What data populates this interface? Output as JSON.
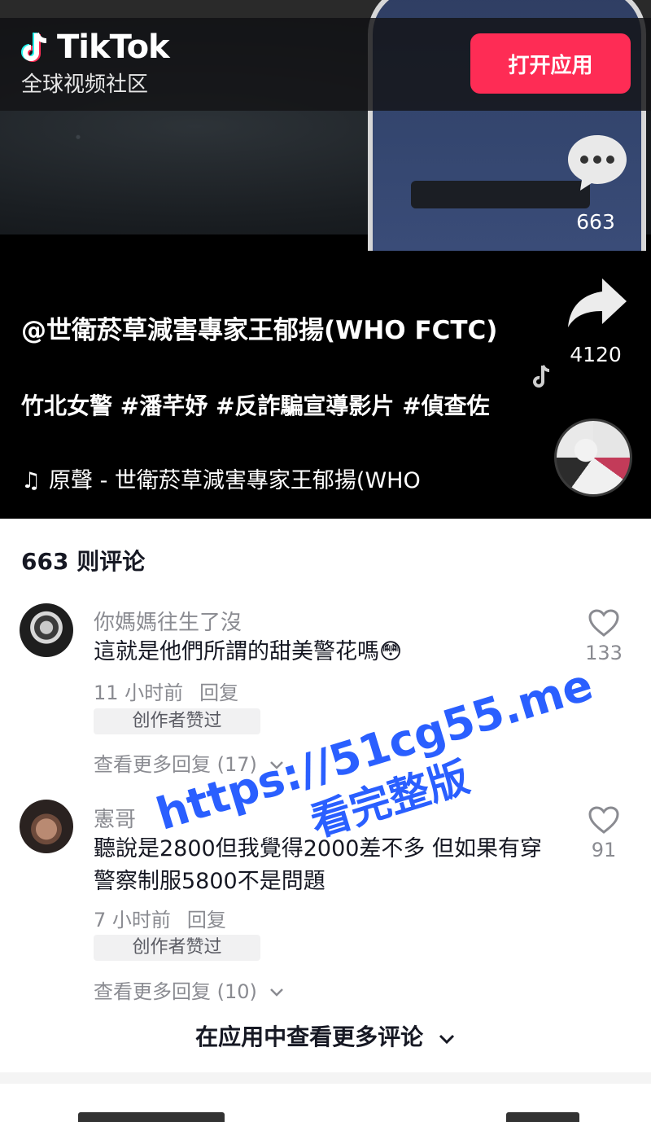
{
  "header": {
    "logo_text": "TikTok",
    "logo_subtitle": "全球视频社区",
    "open_app_label": "打开应用"
  },
  "video": {
    "comment_count": "663",
    "share_count": "4120",
    "caption": "@世衛菸草減害專家王郁揚(WHO FCTC)",
    "tags": "竹北女警 #潘芊妤 #反詐騙宣導影片 #偵查佐",
    "music_glyph": "♫",
    "music": "原聲 - 世衛菸草減害專家王郁揚(WHO"
  },
  "comments_section": {
    "title": "663 则评论",
    "comments": [
      {
        "user": "你媽媽往生了沒",
        "text": "這就是他們所謂的甜美警花嗎😳",
        "time": "11 小时前",
        "reply_label": "回复",
        "badge": "创作者赞过",
        "more_replies": "查看更多回复 (17)",
        "likes": "133"
      },
      {
        "user": "憲哥",
        "text": "聽說是2800但我覺得2000差不多 但如果有穿警察制服5800不是問題",
        "time": "7 小时前",
        "reply_label": "回复",
        "badge": "创作者赞过",
        "more_replies": "查看更多回复 (10)",
        "likes": "91"
      }
    ],
    "see_more": "在应用中查看更多评论"
  },
  "watermark": {
    "line1": "https://51cg55.me",
    "line2": "看完整版"
  },
  "colors": {
    "accent": "#fe2c55",
    "watermark": "#2a5fff",
    "secondary_text": "#8a8b91"
  }
}
